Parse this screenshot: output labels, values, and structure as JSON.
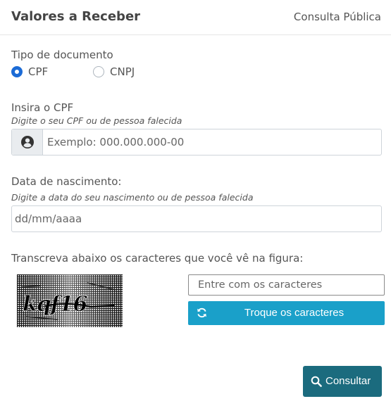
{
  "header": {
    "title": "Valores a Receber",
    "link": "Consulta Pública"
  },
  "document_type": {
    "label": "Tipo de documento",
    "options": [
      "CPF",
      "CNPJ"
    ],
    "selected": "CPF"
  },
  "cpf": {
    "label": "Insira o CPF",
    "hint": "Digite o seu CPF ou de pessoa falecida",
    "placeholder": "Exemplo: 000.000.000-00",
    "icon": "user-circle-icon"
  },
  "birth_date": {
    "label": "Data de nascimento:",
    "hint": "Digite a data do seu nascimento ou de pessoa falecida",
    "placeholder": "dd/mm/aaaa"
  },
  "captcha": {
    "label": "Transcreva abaixo os caracteres que você vê na figura:",
    "image_text": "kqf16",
    "input_placeholder": "Entre com os caracteres",
    "refresh_label": "Troque os caracteres",
    "refresh_icon": "refresh-icon",
    "button_color": "#1aa0c9"
  },
  "submit": {
    "label": "Consultar",
    "icon": "search-icon",
    "color": "#1b6b7e"
  },
  "accent_color": "#1c6bd6"
}
